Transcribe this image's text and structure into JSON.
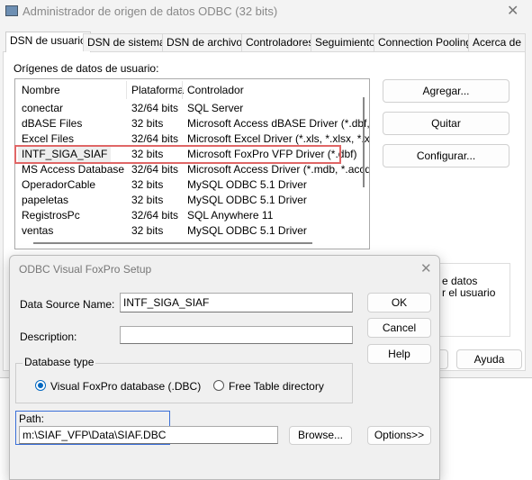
{
  "main": {
    "title": "Administrador de origen de datos ODBC (32 bits)",
    "tabs": [
      "DSN de usuario",
      "DSN de sistema",
      "DSN de archivo",
      "Controladores",
      "Seguimiento",
      "Connection Pooling",
      "Acerca de"
    ],
    "section_label": "Orígenes de datos de usuario:",
    "columns": [
      "Nombre",
      "Plataforma",
      "Controlador"
    ],
    "rows": [
      [
        "conectar",
        "32/64 bits",
        "SQL Server"
      ],
      [
        "dBASE Files",
        "32 bits",
        "Microsoft Access dBASE Driver (*.dbf, *"
      ],
      [
        "Excel Files",
        "32/64 bits",
        "Microsoft Excel Driver (*.xls, *.xlsx, *.xlsn"
      ],
      [
        "INTF_SIGA_SIAF",
        "32 bits",
        "Microsoft FoxPro VFP Driver (*.dbf)"
      ],
      [
        "MS Access Database",
        "32/64 bits",
        "Microsoft Access Driver (*.mdb, *.accdb"
      ],
      [
        "OperadorCable",
        "32 bits",
        "MySQL ODBC 5.1 Driver"
      ],
      [
        "papeletas",
        "32 bits",
        "MySQL ODBC 5.1 Driver"
      ],
      [
        "RegistrosPc",
        "32/64 bits",
        "SQL Anywhere 11"
      ],
      [
        "ventas",
        "32 bits",
        "MySQL ODBC 5.1 Driver"
      ]
    ],
    "selected_row": "INTF_SIGA_SIAF",
    "buttons": {
      "add": "Agregar...",
      "remove": "Quitar",
      "configure": "Configurar...",
      "help": "Ayuda"
    },
    "info_text": [
      "e datos",
      "r el usuario"
    ]
  },
  "dialog": {
    "title": "ODBC Visual FoxPro Setup",
    "dsn_label": "Data Source Name:",
    "dsn_value": "INTF_SIGA_SIAF",
    "desc_label": "Description:",
    "desc_value": "",
    "group_label": "Database type",
    "radio_dbc": "Visual FoxPro database (.DBC)",
    "radio_free": "Free Table directory",
    "selected": "dbc",
    "path_label": "Path:",
    "path_value": "m:\\SIAF_VFP\\Data\\SIAF.DBC",
    "buttons": {
      "ok": "OK",
      "cancel": "Cancel",
      "help": "Help",
      "browse": "Browse...",
      "options": "Options>>"
    }
  },
  "colors": {
    "highlight": "#e06666",
    "path_box": "#3a6fd8",
    "radio": "#0067c0"
  }
}
